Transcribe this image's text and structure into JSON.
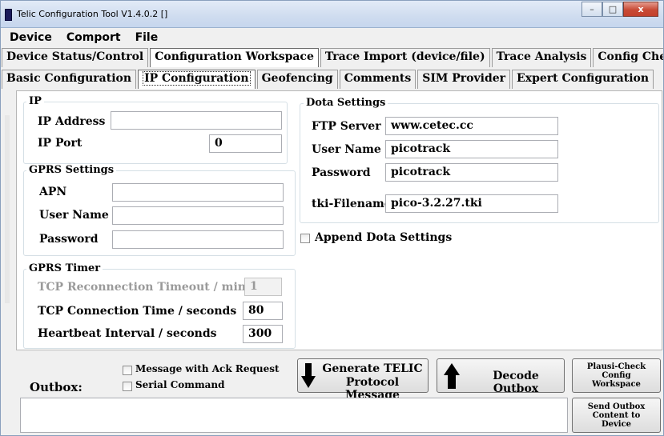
{
  "window": {
    "title": "Telic Configuration Tool V1.4.0.2 []",
    "minimize": "–",
    "maximize": "□",
    "close": "x"
  },
  "menu": [
    "Device",
    "Comport",
    "File"
  ],
  "main_tabs": [
    "Device Status/Control",
    "Configuration Workspace",
    "Trace Import (device/file)",
    "Trace Analysis",
    "Config Checker"
  ],
  "sub_tabs": [
    "Basic Configuration",
    "IP Configuration",
    "Geofencing",
    "Comments",
    "SIM Provider",
    "Expert Configuration"
  ],
  "ip": {
    "title": "IP",
    "address_label": "IP Address",
    "address_value": "",
    "port_label": "IP Port",
    "port_value": "0"
  },
  "gprs": {
    "title": "GPRS Settings",
    "apn_label": "APN",
    "apn_value": "",
    "user_label": "User Name",
    "user_value": "",
    "password_label": "Password",
    "password_value": ""
  },
  "timer": {
    "title": "GPRS Timer",
    "reconnect_label": "TCP Reconnection Timeout / min",
    "reconnect_value": "1",
    "connection_label": "TCP Connection Time / seconds",
    "connection_value": "80",
    "heartbeat_label": "Heartbeat Interval / seconds",
    "heartbeat_value": "300"
  },
  "dota": {
    "title": "Dota Settings",
    "ftp_label": "FTP Server",
    "ftp_value": "www.cetec.cc",
    "user_label": "User Name",
    "user_value": "picotrack",
    "password_label": "Password",
    "password_value": "picotrack",
    "tki_label": "tki-Filename",
    "tki_value": "pico-3.2.27.tki",
    "append_label": "Append Dota Settings"
  },
  "outbox": {
    "label": "Outbox:",
    "ack_label": "Message with Ack Request",
    "serial_label": "Serial Command",
    "generate_label_1": "Generate TELIC",
    "generate_label_2": "Protocol Message",
    "decode_label": "Decode Outbox",
    "plausi_label_1": "Plausi-Check",
    "plausi_label_2": "Config",
    "plausi_label_3": "Workspace",
    "send_label_1": "Send Outbox",
    "send_label_2": "Content to",
    "send_label_3": "Device",
    "content": ""
  }
}
